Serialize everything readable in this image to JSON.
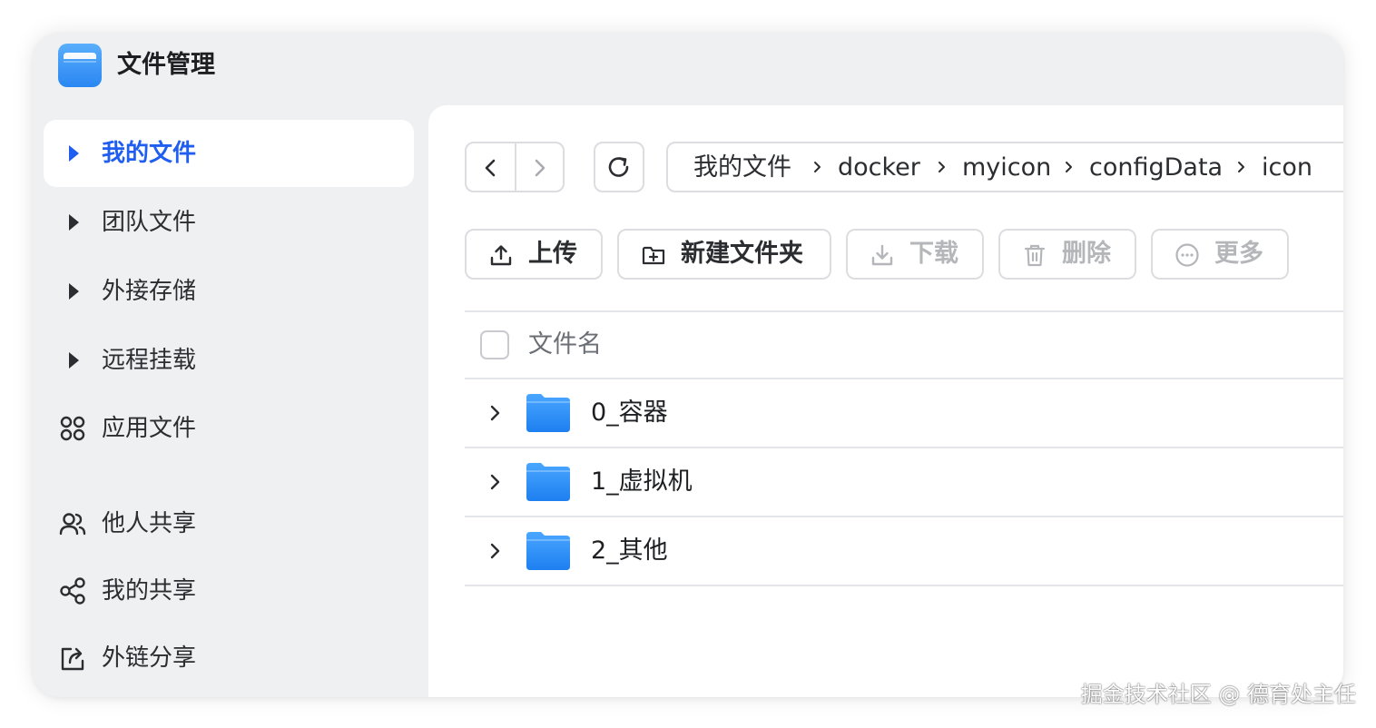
{
  "app": {
    "title": "文件管理",
    "icon": "folder-app-icon"
  },
  "sidebar": {
    "items": [
      {
        "label": "我的文件",
        "icon": "caret-right-icon",
        "active": true
      },
      {
        "label": "团队文件",
        "icon": "caret-right-icon"
      },
      {
        "label": "外接存储",
        "icon": "caret-right-icon"
      },
      {
        "label": "远程挂载",
        "icon": "caret-right-icon"
      },
      {
        "label": "应用文件",
        "icon": "apps-grid-icon"
      },
      {
        "label": "他人共享",
        "icon": "users-icon"
      },
      {
        "label": "我的共享",
        "icon": "share-icon"
      },
      {
        "label": "外链分享",
        "icon": "external-share-icon"
      }
    ]
  },
  "navigation": {
    "back_icon": "chevron-left-icon",
    "forward_icon": "chevron-right-icon",
    "refresh_icon": "refresh-icon"
  },
  "breadcrumb": {
    "items": [
      "我的文件",
      "docker",
      "myicon",
      "configData",
      "icon"
    ],
    "separator_icon": "chevron-right-icon"
  },
  "toolbar": {
    "upload": {
      "label": "上传",
      "icon": "upload-icon"
    },
    "new_folder": {
      "label": "新建文件夹",
      "icon": "folder-plus-icon"
    },
    "download": {
      "label": "下载",
      "icon": "download-icon",
      "disabled": true
    },
    "delete": {
      "label": "删除",
      "icon": "trash-icon",
      "disabled": true
    },
    "more": {
      "label": "更多",
      "icon": "more-icon",
      "disabled": true
    }
  },
  "table": {
    "header": {
      "name": "文件名"
    },
    "rows": [
      {
        "name": "0_容器",
        "type": "folder"
      },
      {
        "name": "1_虚拟机",
        "type": "folder"
      },
      {
        "name": "2_其他",
        "type": "folder"
      }
    ]
  },
  "colors": {
    "accent": "#1f5ef0",
    "sidebar_bg": "#eff0f2",
    "folder": "#2a8cf5"
  },
  "watermark": "掘金技术社区 @ 德育处主任"
}
